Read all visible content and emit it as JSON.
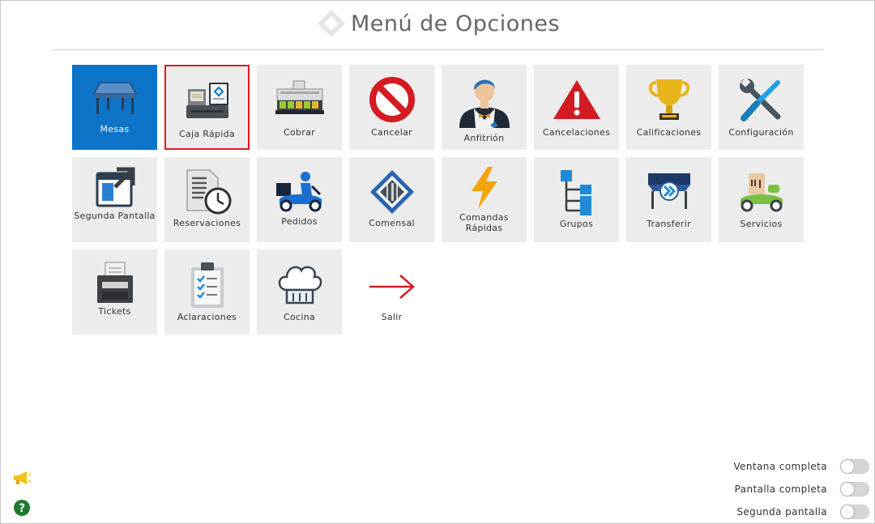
{
  "header": {
    "title": "Menú de Opciones"
  },
  "tiles": [
    {
      "label": "Mesas",
      "icon": "table-icon",
      "state": "active"
    },
    {
      "label": "Caja Rápida",
      "icon": "cash-register-icon",
      "state": "selected"
    },
    {
      "label": "Cobrar",
      "icon": "cash-drawer-icon"
    },
    {
      "label": "Cancelar",
      "icon": "prohibited-icon"
    },
    {
      "label": "Anfitrión",
      "icon": "host-icon"
    },
    {
      "label": "Cancelaciones",
      "icon": "warning-icon"
    },
    {
      "label": "Calificaciones",
      "icon": "trophy-icon"
    },
    {
      "label": "Configuración",
      "icon": "tools-icon"
    },
    {
      "label": "Segunda Pantalla",
      "icon": "external-screen-icon"
    },
    {
      "label": "Reservaciones",
      "icon": "reservations-clock-icon"
    },
    {
      "label": "Pedidos",
      "icon": "delivery-scooter-icon"
    },
    {
      "label": "Comensal",
      "icon": "diner-cutlery-icon"
    },
    {
      "label": "Comandas Rápidas",
      "icon": "lightning-icon"
    },
    {
      "label": "Grupos",
      "icon": "groups-tree-icon"
    },
    {
      "label": "Transferir",
      "icon": "transfer-table-icon"
    },
    {
      "label": "Servicios",
      "icon": "service-scooter-icon"
    },
    {
      "label": "Tickets",
      "icon": "ticket-printer-icon"
    },
    {
      "label": "Aclaraciones",
      "icon": "clipboard-checklist-icon"
    },
    {
      "label": "Cocina",
      "icon": "chef-hat-icon"
    },
    {
      "label": "Salir",
      "icon": "exit-arrow-icon",
      "state": "blank"
    }
  ],
  "toggles": [
    {
      "label": "Ventana completa",
      "on": false
    },
    {
      "label": "Pantalla completa",
      "on": false
    },
    {
      "label": "Segunda pantalla",
      "on": false
    }
  ],
  "bottom_icons": [
    "megaphone-icon",
    "help-icon"
  ],
  "colors": {
    "active_tile": "#0d74c8",
    "selected_border": "#e0191f",
    "tile_bg": "#ececec"
  }
}
